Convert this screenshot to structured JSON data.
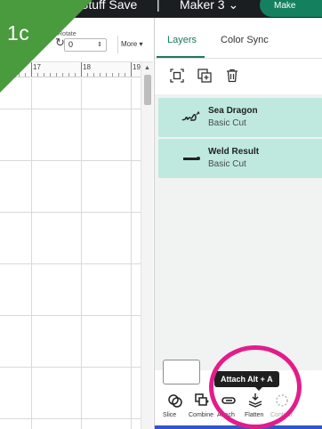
{
  "step_badge": {
    "label": "1c",
    "color": "#4a9a3e"
  },
  "topbar": {
    "left_text": "Stuff  Save",
    "separator": "|",
    "machine": "Maker 3 ⌄",
    "make_button": "Make"
  },
  "canvas": {
    "rotate_label": "Rotate",
    "rotate_value": "0",
    "more_label": "More ▾",
    "ruler_labels": [
      "17",
      "18",
      "19"
    ]
  },
  "panel": {
    "tabs": [
      {
        "label": "Layers",
        "active": true
      },
      {
        "label": "Color Sync",
        "active": false
      }
    ],
    "tool_icons": [
      "group-icon",
      "duplicate-icon",
      "delete-icon"
    ],
    "layers": [
      {
        "name": "Sea Dragon",
        "type": "Basic Cut",
        "thumb_icon": "sea-dragon-thumbnail"
      },
      {
        "name": "Weld Result",
        "type": "Basic Cut",
        "thumb_icon": "weld-result-thumbnail"
      }
    ],
    "tooltip": "Attach Alt + A",
    "bottom_tools": [
      {
        "label": "Slice",
        "icon": "slice-icon",
        "enabled": true
      },
      {
        "label": "Combine",
        "icon": "combine-icon",
        "enabled": true
      },
      {
        "label": "Attach",
        "icon": "attach-icon",
        "enabled": true
      },
      {
        "label": "Flatten",
        "icon": "flatten-icon",
        "enabled": true
      },
      {
        "label": "Contour",
        "icon": "contour-icon",
        "enabled": false
      }
    ]
  },
  "colors": {
    "accent": "#1a7a57",
    "layer_selected": "#bfe9de",
    "highlight_ring": "#e21d8a",
    "bottom_bar": "#2e58c9"
  }
}
